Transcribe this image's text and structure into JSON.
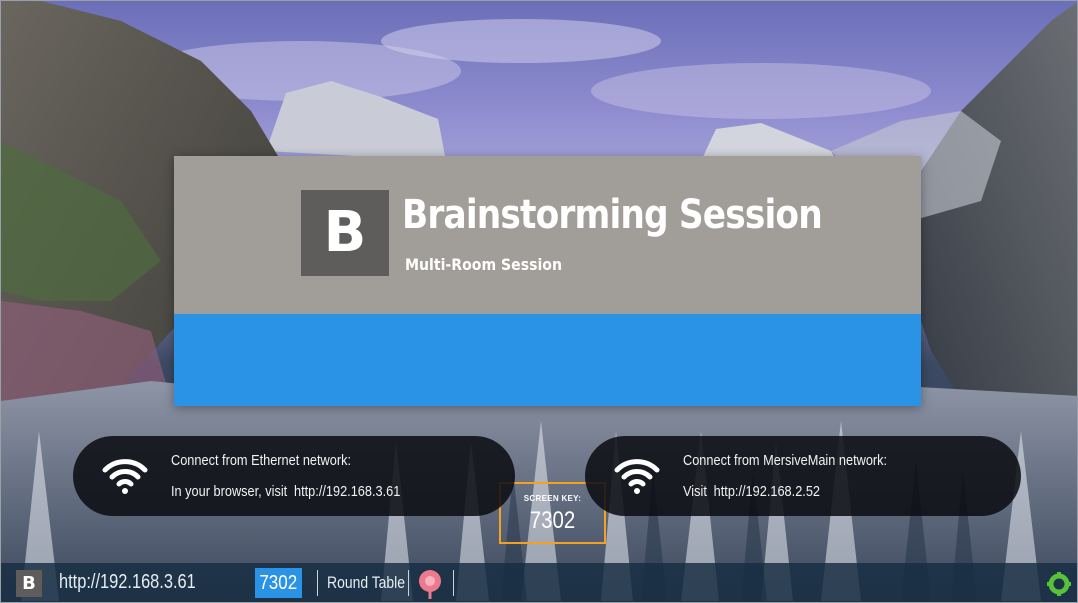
{
  "session": {
    "logo_letter": "B",
    "title": "Brainstorming Session",
    "subtitle": "Multi-Room Session",
    "screen_key_label": "SCREEN KEY:",
    "screen_key": "7302"
  },
  "connections": [
    {
      "icon": "wifi-icon",
      "line1": "Connect from Ethernet network:",
      "line2_prefix": "In your browser, visit",
      "url": "http://192.168.3.61"
    },
    {
      "icon": "wifi-icon",
      "line1": "Connect from MersiveMain network:",
      "line2_prefix": "Visit",
      "url": "http://192.168.2.52"
    }
  ],
  "status_bar": {
    "logo_letter": "B",
    "url": "http://192.168.3.61",
    "screen_key": "7302",
    "room_name": "Round Table",
    "pin_icon": "map-pin-icon",
    "status_icon": "gear-status-icon"
  },
  "colors": {
    "brand_gray": "#a19d99",
    "logo_box": "#5e5d5c",
    "accent_blue": "#2a93e6",
    "highlight_orange": "#f4a020",
    "status_green": "#57c23a",
    "pin_pink": "#ec7a8c"
  }
}
